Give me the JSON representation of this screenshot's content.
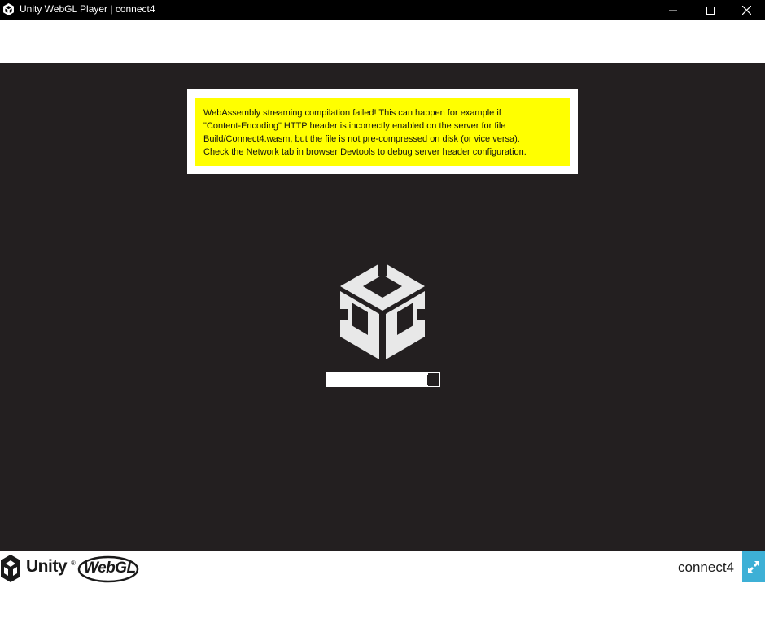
{
  "window": {
    "title": "Unity WebGL Player | connect4"
  },
  "warning": {
    "lines": [
      "WebAssembly streaming compilation failed! This can happen for example if",
      "\"Content-Encoding\" HTTP header is incorrectly enabled on the server for file",
      "Build/Connect4.wasm, but the file is not pre-compressed on disk (or vice versa).",
      "Check the Network tab in browser Devtools to debug server header configuration."
    ],
    "background_color": "#ffff00"
  },
  "loading": {
    "progress_fraction": 0.9
  },
  "footer": {
    "unity_label": "Unity",
    "unity_tm": "®",
    "webgl_label": "WebGL",
    "game_title": "connect4",
    "fullscreen_color": "#3db0d6"
  },
  "colors": {
    "canvas_background": "#231f20",
    "titlebar_background": "#000000"
  },
  "icons": {
    "app": "unity-icon",
    "minimize": "minimize-icon",
    "maximize": "maximize-icon",
    "close": "close-icon",
    "logo": "unity-logo-icon",
    "fullscreen": "fullscreen-icon"
  }
}
